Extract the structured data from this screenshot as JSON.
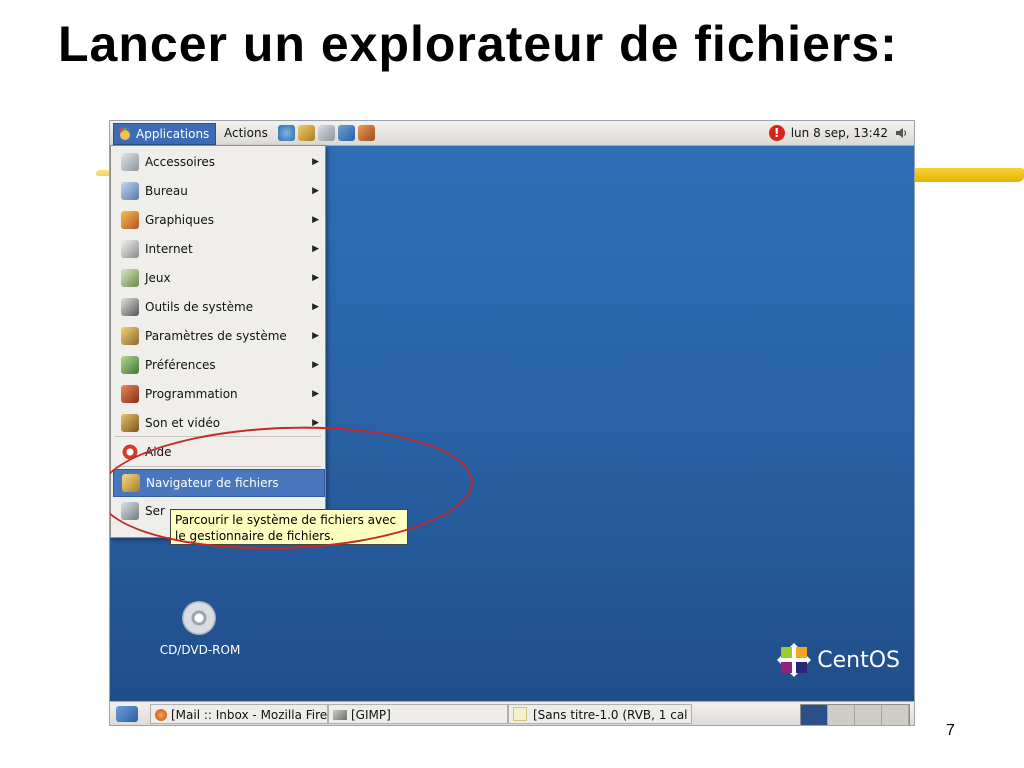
{
  "slide": {
    "title": "Lancer un explorateur de fichiers:",
    "page_number": "7"
  },
  "top_panel": {
    "applications_label": "Applications",
    "actions_label": "Actions",
    "clock": "lun  8 sep, 13:42"
  },
  "app_menu": {
    "items": [
      {
        "label": "Accessoires",
        "icon": "accessories-icon",
        "submenu": true
      },
      {
        "label": "Bureau",
        "icon": "office-icon",
        "submenu": true
      },
      {
        "label": "Graphiques",
        "icon": "graphics-icon",
        "submenu": true
      },
      {
        "label": "Internet",
        "icon": "internet-icon",
        "submenu": true
      },
      {
        "label": "Jeux",
        "icon": "games-icon",
        "submenu": true
      },
      {
        "label": "Outils de système",
        "icon": "system-tools-icon",
        "submenu": true
      },
      {
        "label": "Paramètres de système",
        "icon": "system-settings-icon",
        "submenu": true
      },
      {
        "label": "Préférences",
        "icon": "preferences-icon",
        "submenu": true
      },
      {
        "label": "Programmation",
        "icon": "programming-icon",
        "submenu": true
      },
      {
        "label": "Son et vidéo",
        "icon": "sound-video-icon",
        "submenu": true
      },
      {
        "label": "Aide",
        "icon": "help-icon",
        "submenu": false
      },
      {
        "label": "Navigateur de fichiers",
        "icon": "file-browser-icon",
        "submenu": false,
        "selected": true
      },
      {
        "label": "Ser",
        "icon": "server-icon",
        "submenu": false
      }
    ],
    "tooltip": "Parcourir le système de fichiers avec le gestionnaire de fichiers."
  },
  "desktop": {
    "cd_label": "CD/DVD-ROM",
    "brand": "CentOS"
  },
  "taskbar": {
    "tasks": [
      {
        "label": "[Mail :: Inbox - Mozilla Fire",
        "icon": "firefox-icon"
      },
      {
        "label": "[GIMP]",
        "icon": "gimp-icon"
      },
      {
        "label": "[Sans titre-1.0 (RVB, 1 cal",
        "icon": "image-icon"
      }
    ]
  },
  "colors": {
    "desktop_blue": "#2b64a8",
    "menu_highlight": "#4a76bd",
    "annotation_red": "#c22a2a",
    "tooltip_yellow": "#ffffbf"
  }
}
